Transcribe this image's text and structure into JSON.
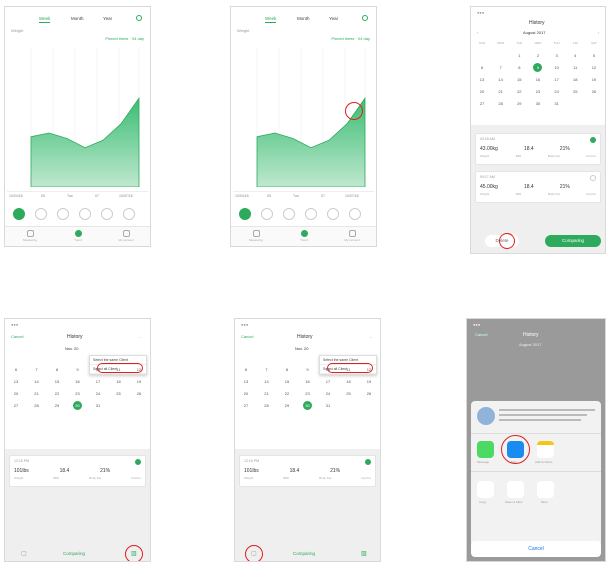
{
  "weight_screen": {
    "tabs": [
      "Week",
      "Month",
      "Year"
    ],
    "unit_label": "Weight",
    "period_label": "Pinned times · 04 day",
    "x_labels": [
      "10/04/18",
      "05",
      "Tue",
      "07",
      "10/07/18"
    ],
    "nav": [
      "Measuring",
      "Trend",
      "My account"
    ],
    "chart_values": [
      58.2,
      58.4,
      58.1,
      57.6,
      58.0,
      58.9,
      60.3
    ],
    "accent": "#2eaa5c"
  },
  "history_screen": {
    "title": "History",
    "cancel": "Cancel",
    "month": "August 2017",
    "month_short": "Nov. 20",
    "weekdays": [
      "SUN",
      "MON",
      "TUE",
      "WED",
      "THU",
      "FRI",
      "SAT"
    ],
    "weeks": [
      [
        "",
        "",
        "1",
        "2",
        "3",
        "4",
        "5"
      ],
      [
        "6",
        "7",
        "8",
        "9",
        "10",
        "11",
        "12"
      ],
      [
        "13",
        "14",
        "15",
        "16",
        "17",
        "18",
        "19"
      ],
      [
        "20",
        "21",
        "22",
        "23",
        "24",
        "25",
        "26"
      ],
      [
        "27",
        "28",
        "29",
        "30",
        "31",
        "",
        ""
      ]
    ],
    "records": [
      {
        "time": "02:15 AM",
        "values": [
          "43.00kg",
          "18.4",
          "21%",
          ""
        ],
        "labels": [
          "Weight",
          "BMI",
          "Body Fat",
          "Fat Fre"
        ]
      },
      {
        "time": "09:17 AM",
        "values": [
          "45.00kg",
          "18.4",
          "21%",
          ""
        ],
        "labels": [
          "Weight",
          "BMI",
          "Body Fat",
          "Fat Fre"
        ]
      }
    ],
    "record_small": {
      "time": "12:15 PM",
      "values": [
        "101lbs",
        "18.4",
        "21%"
      ],
      "labels": [
        "Weight",
        "BMI",
        "Body Fat",
        "Fat Fre"
      ]
    },
    "delete_label": "Delete",
    "comparing_label": "Comparing",
    "menu": [
      "Select the same Client",
      "Select all Client"
    ],
    "more": "...",
    "share": {
      "mail_label": "Mail",
      "messages_label": "Message",
      "add_label": "Add to Notes",
      "copy_label": "Copy",
      "save_label": "Save to Files",
      "more_label": "More",
      "cancel": "Cancel"
    }
  }
}
